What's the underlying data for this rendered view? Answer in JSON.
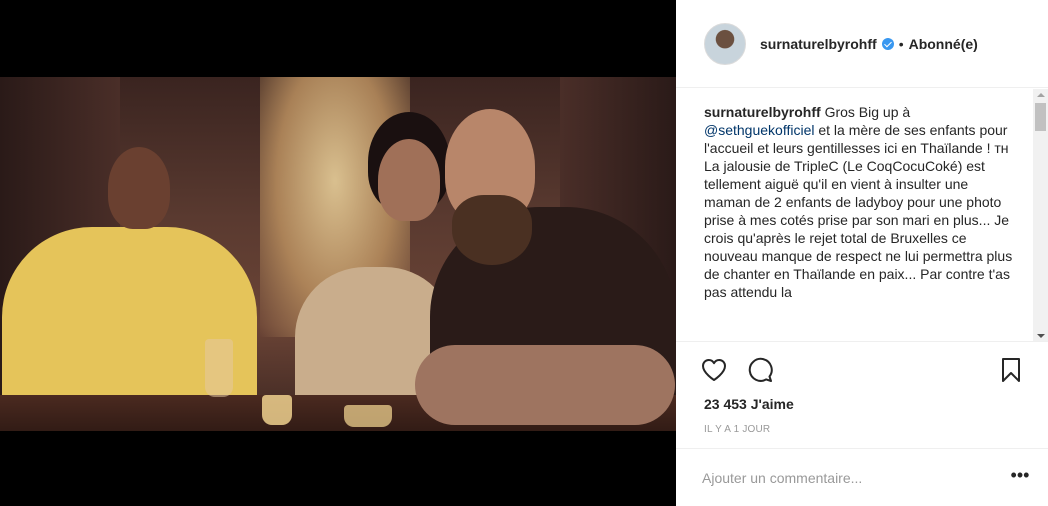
{
  "post": {
    "username": "surnaturelbyrohff",
    "separator": "•",
    "follow_status": "Abonné(e)",
    "caption": {
      "username": "surnaturelbyrohff",
      "text_start": " Gros Big up à ",
      "mention": "@sethguekofficiel",
      "text_rest": " et la mère de ses enfants pour l'accueil et leurs gentillesses ici en Thaïlande ! ᴛʜ La jalousie de TripleC (Le CoqCocuCoké) est tellement aiguë qu'il en vient à insulter une maman de 2 enfants de ladyboy pour une photo prise à mes cotés prise par son mari en plus... Je crois qu'après le rejet total de Bruxelles ce nouveau manque de respect ne lui permettra plus de chanter en Thaïlande en paix... Par contre t'as pas attendu la"
    },
    "likes": "23 453 J'aime",
    "time_ago": "IL Y A 1 JOUR",
    "comment_placeholder": "Ajouter un commentaire...",
    "more_label": "•••"
  },
  "icons": {
    "like": "heart-icon",
    "comment": "comment-icon",
    "save": "bookmark-icon",
    "verified": "verified-badge-icon"
  },
  "colors": {
    "verified": "#3897f0",
    "mention": "#003569",
    "timestamp": "#999999"
  }
}
